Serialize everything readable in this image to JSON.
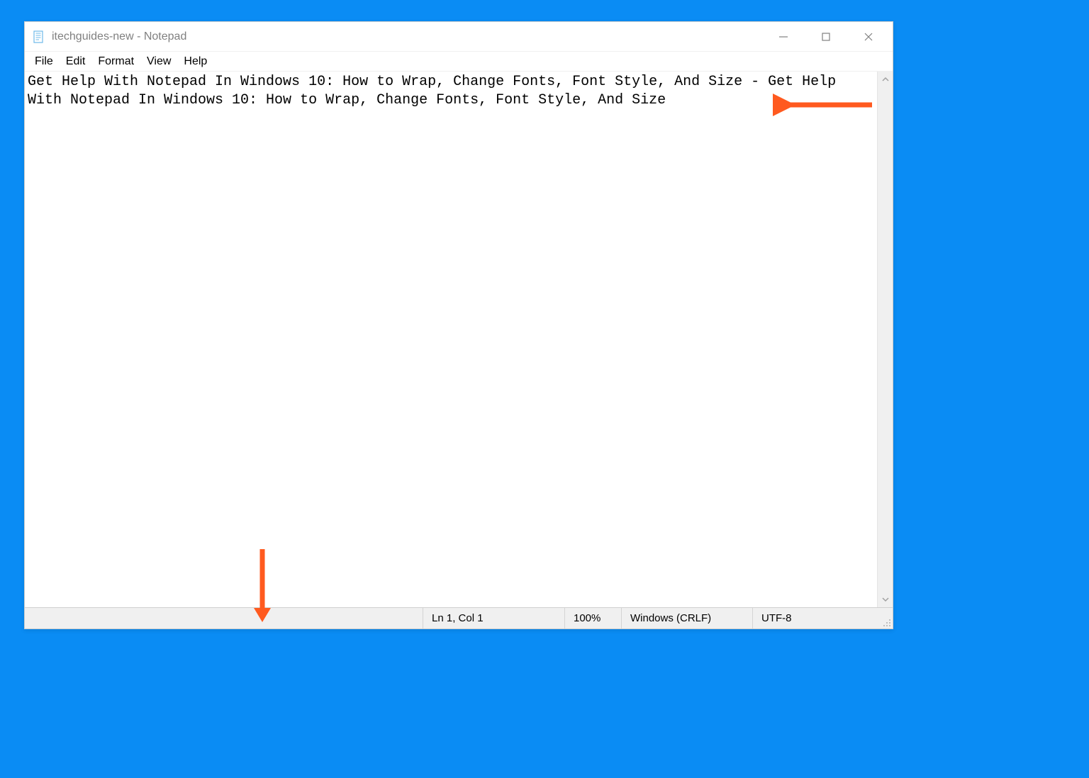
{
  "window": {
    "title": "itechguides-new - Notepad"
  },
  "menubar": {
    "items": [
      "File",
      "Edit",
      "Format",
      "View",
      "Help"
    ]
  },
  "editor": {
    "content": "Get Help With Notepad In Windows 10: How to Wrap, Change Fonts, Font Style, And Size - Get Help With Notepad In Windows 10: How to Wrap, Change Fonts, Font Style, And Size"
  },
  "statusbar": {
    "lncol": "Ln 1, Col 1",
    "zoom": "100%",
    "line_ending": "Windows (CRLF)",
    "encoding": "UTF-8"
  }
}
